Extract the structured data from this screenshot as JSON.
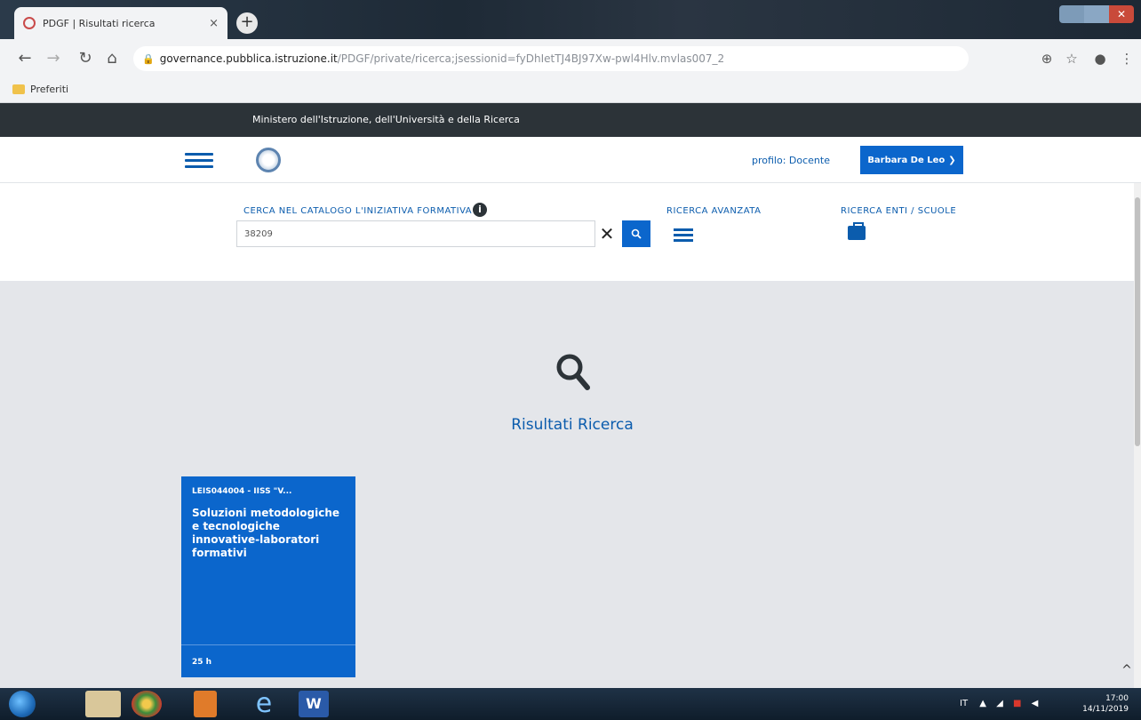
{
  "browser": {
    "tab_title": "PDGF | Risultati ricerca",
    "tab_close": "×",
    "new_tab": "+",
    "url_host": "governance.pubblica.istruzione.it",
    "url_path": "/PDGF/private/ricerca;jsessionid=fyDhIetTJ4BJ97Xw-pwl4Hlv.mvlas007_2",
    "bookmarks_folder": "Preferiti",
    "icons": [
      "back-icon",
      "forward-icon",
      "reload-icon",
      "home-icon",
      "lock-icon",
      "zoom-icon",
      "star-icon",
      "account-icon",
      "menu-icon"
    ]
  },
  "site": {
    "ministry": "Ministero dell'Istruzione, dell'Università e della Ricerca",
    "profile": "profilo: Docente",
    "user": "Barbara De Leo"
  },
  "search": {
    "catalog_label": "CERCA NEL CATALOGO L'INIZIATIVA FORMATIVA",
    "query": "38209",
    "advanced_label": "RICERCA AVANZATA",
    "schools_label": "RICERCA ENTI / SCUOLE"
  },
  "results": {
    "title": "Risultati Ricerca",
    "cards": [
      {
        "code": "LEIS044004 - IISS \"V...",
        "title": "Soluzioni metodologiche e tecnologiche innovative-laboratori formativi",
        "hours": "25 h"
      }
    ]
  },
  "taskbar": {
    "lang": "IT",
    "time": "17:00",
    "date": "14/11/2019"
  },
  "colors": {
    "primary": "#0b66cc",
    "dark_bar": "#2c3338",
    "results_bg": "#e4e6ea"
  }
}
